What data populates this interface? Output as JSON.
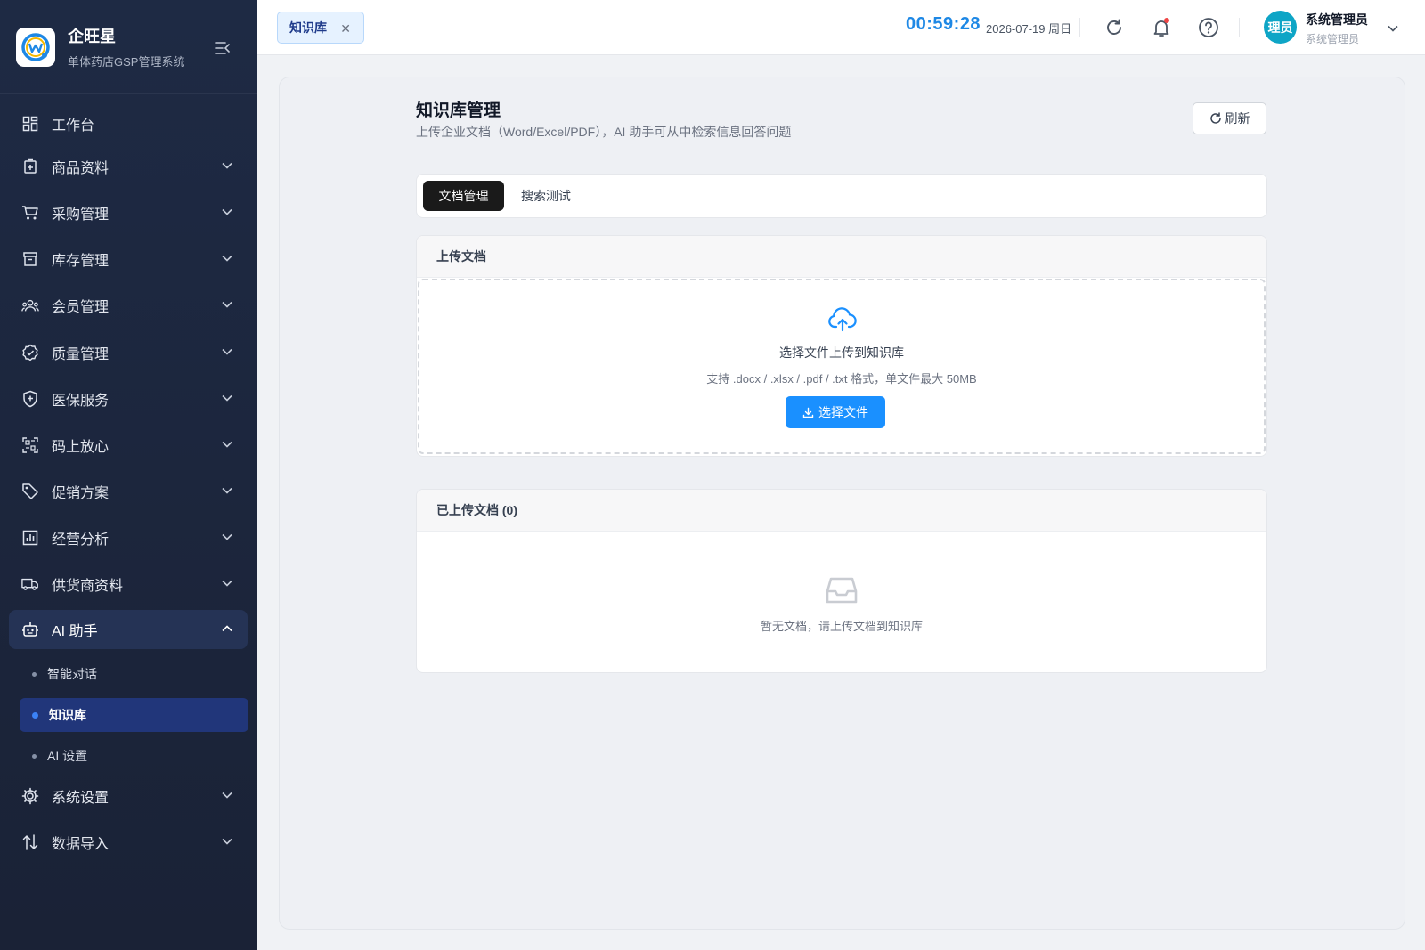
{
  "brand": {
    "name": "企旺星",
    "subtitle": "单体药店GSP管理系统"
  },
  "sidebar": {
    "items": [
      {
        "label": "工作台",
        "icon": "dashboard-icon",
        "has_children": false
      },
      {
        "label": "商品资料",
        "icon": "product-icon",
        "has_children": true
      },
      {
        "label": "采购管理",
        "icon": "cart-icon",
        "has_children": true
      },
      {
        "label": "库存管理",
        "icon": "archive-icon",
        "has_children": true
      },
      {
        "label": "会员管理",
        "icon": "users-icon",
        "has_children": true
      },
      {
        "label": "质量管理",
        "icon": "badge-check-icon",
        "has_children": true
      },
      {
        "label": "医保服务",
        "icon": "shield-plus-icon",
        "has_children": true
      },
      {
        "label": "码上放心",
        "icon": "qrcode-icon",
        "has_children": true
      },
      {
        "label": "促销方案",
        "icon": "tag-icon",
        "has_children": true
      },
      {
        "label": "经营分析",
        "icon": "bar-chart-icon",
        "has_children": true
      },
      {
        "label": "供货商资料",
        "icon": "truck-icon",
        "has_children": true
      },
      {
        "label": "AI 助手",
        "icon": "robot-icon",
        "has_children": true,
        "expanded": true
      },
      {
        "label": "系统设置",
        "icon": "gear-icon",
        "has_children": true
      },
      {
        "label": "数据导入",
        "icon": "import-icon",
        "has_children": true
      }
    ],
    "ai_children": [
      {
        "label": "智能对话",
        "active": false
      },
      {
        "label": "知识库",
        "active": true
      },
      {
        "label": "AI 设置",
        "active": false
      }
    ]
  },
  "header": {
    "open_tab": "知识库",
    "clock": "00:59:28",
    "date": "2026-07-19 周日",
    "user": {
      "avatar_text": "理员",
      "name": "系统管理员",
      "role": "系统管理员"
    }
  },
  "page": {
    "title": "知识库管理",
    "description": "上传企业文档（Word/Excel/PDF），AI 助手可从中检索信息回答问题",
    "refresh_label": "刷新",
    "tabs": [
      {
        "label": "文档管理",
        "active": true
      },
      {
        "label": "搜索测试",
        "active": false
      }
    ],
    "upload": {
      "heading": "上传文档",
      "title": "选择文件上传到知识库",
      "hint": "支持 .docx / .xlsx / .pdf / .txt 格式，单文件最大 50MB",
      "button": "选择文件"
    },
    "documents": {
      "heading": "已上传文档 (0)",
      "empty_text": "暂无文档，请上传文档到知识库"
    }
  },
  "colors": {
    "sidebar_bg": "#1e2a44",
    "accent": "#1a90ff",
    "clock": "#1e88e5",
    "active_submenu": "#21367a"
  }
}
